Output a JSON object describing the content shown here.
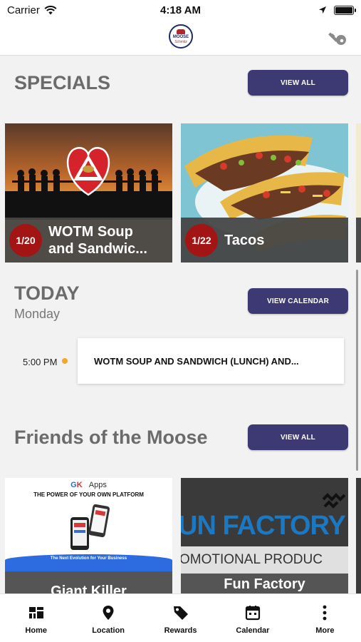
{
  "status_bar": {
    "carrier": "Carrier",
    "time": "4:18 AM"
  },
  "header": {
    "logo_line1": "MOOSE",
    "logo_line2": "Schmitz"
  },
  "specials": {
    "title": "SPECIALS",
    "button": "VIEW ALL",
    "cards": [
      {
        "date": "1/20",
        "title": "WOTM Soup\nand Sandwic..."
      },
      {
        "date": "1/22",
        "title": "Tacos"
      }
    ]
  },
  "today": {
    "title": "TODAY",
    "day": "Monday",
    "button": "VIEW CALENDAR",
    "events": [
      {
        "time": "5:00 PM",
        "title": "WOTM SOUP AND SANDWICH (LUNCH) AND..."
      }
    ]
  },
  "friends": {
    "title": "Friends of the Moose",
    "button": "VIEW ALL",
    "cards": [
      {
        "name": "Giant Killer",
        "brand": "Apps",
        "headline": "THE POWER OF YOUR OWN PLATFORM",
        "banner": "The Next Evolution for Your Business"
      },
      {
        "name": "Fun Factory",
        "art_line1": "UN FACTORY",
        "art_line2": "OMOTIONAL PRODUC"
      }
    ]
  },
  "tab_bar": {
    "items": [
      {
        "label": "Home",
        "icon": "grid-icon"
      },
      {
        "label": "Location",
        "icon": "map-pin-icon"
      },
      {
        "label": "Rewards",
        "icon": "tag-icon"
      },
      {
        "label": "Calendar",
        "icon": "calendar-icon"
      },
      {
        "label": "More",
        "icon": "more-vertical-icon"
      }
    ]
  },
  "colors": {
    "button": "#3d3a73",
    "badge": "#a31515",
    "event_dot": "#f5a623",
    "title_gray": "#6b6b6b"
  }
}
